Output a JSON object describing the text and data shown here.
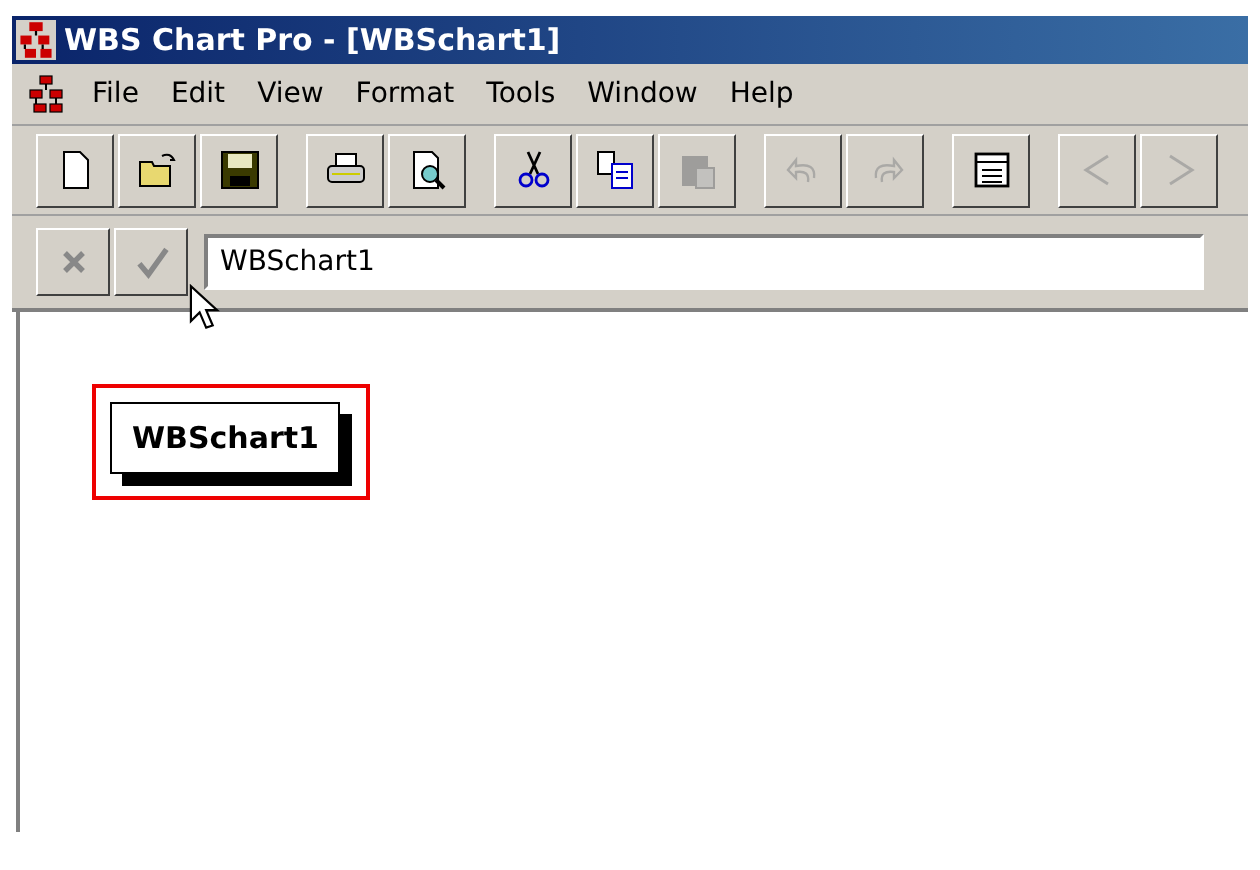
{
  "window": {
    "title": "WBS Chart Pro - [WBSchart1]"
  },
  "menu": [
    "File",
    "Edit",
    "View",
    "Format",
    "Tools",
    "Window",
    "Help"
  ],
  "toolbar": [
    [
      {
        "kind": "new",
        "disabled": false
      },
      {
        "kind": "open",
        "disabled": false
      },
      {
        "kind": "save",
        "disabled": false
      }
    ],
    [
      {
        "kind": "print",
        "disabled": false
      },
      {
        "kind": "preview",
        "disabled": false
      }
    ],
    [
      {
        "kind": "cut",
        "disabled": false
      },
      {
        "kind": "copy",
        "disabled": false
      },
      {
        "kind": "paste",
        "disabled": true
      }
    ],
    [
      {
        "kind": "undo",
        "disabled": true
      },
      {
        "kind": "redo",
        "disabled": true
      }
    ],
    [
      {
        "kind": "properties",
        "disabled": false
      }
    ],
    [
      {
        "kind": "prev",
        "disabled": true
      },
      {
        "kind": "next",
        "disabled": true
      }
    ]
  ],
  "entry_bar": {
    "buttons": [
      {
        "kind": "cancel",
        "disabled": true
      },
      {
        "kind": "accept",
        "disabled": true
      }
    ],
    "value": "WBSchart1"
  },
  "chart": {
    "nodes": [
      {
        "label": "WBSchart1",
        "selected": true
      }
    ]
  }
}
